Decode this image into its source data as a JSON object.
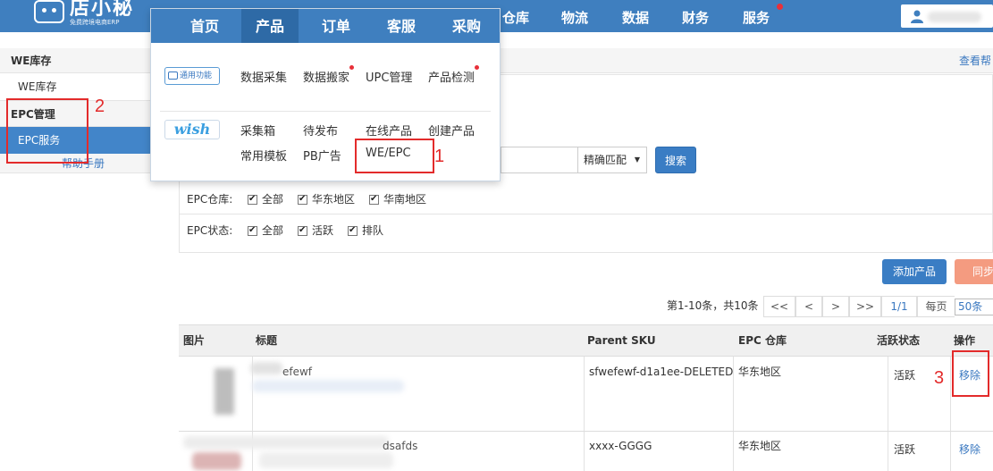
{
  "logo": {
    "name": "店小秘",
    "sub": "免费跨境电商ERP"
  },
  "nav": {
    "right_items": [
      "仓库",
      "物流",
      "数据",
      "财务",
      "服务"
    ]
  },
  "menu": {
    "tabs": [
      "首页",
      "产品",
      "订单",
      "客服",
      "采购"
    ],
    "common_badge": "通用功能",
    "common_items": [
      "数据采集",
      "数据搬家",
      "UPC管理",
      "产品检测"
    ],
    "wish_badge": "wish",
    "wish_items_row1": [
      "采集箱",
      "待发布",
      "在线产品",
      "创建产品"
    ],
    "wish_items_row2": [
      "常用模板",
      "PB广告",
      "WE/EPC"
    ]
  },
  "sidebar": {
    "we_group": "WE库存",
    "we_item": "WE库存",
    "epc_group": "EPC管理",
    "epc_item": "EPC服务",
    "help": "帮助手册"
  },
  "breadcrumb": {
    "help_link": "查看帮"
  },
  "search": {
    "match_mode": "精确匹配",
    "button": "搜索"
  },
  "filters": {
    "warehouse_label": "EPC仓库:",
    "warehouse_options": [
      "全部",
      "华东地区",
      "华南地区"
    ],
    "status_label": "EPC状态:",
    "status_options": [
      "全部",
      "活跃",
      "排队"
    ]
  },
  "actions": {
    "add": "添加产品",
    "sync": "同步"
  },
  "pager": {
    "summary": "第1-10条，共10条",
    "first": "<<",
    "prev": "<",
    "next": ">",
    "last": ">>",
    "page": "1/1",
    "per_page_label": "每页",
    "per_page_value": "50条"
  },
  "table": {
    "headers": [
      "图片",
      "标题",
      "Parent SKU",
      "EPC 仓库",
      "活跃状态",
      "操作"
    ],
    "rows": [
      {
        "title": "efewf",
        "sku": "sfwefewf-d1a1ee-DELETED",
        "warehouse": "华东地区",
        "status": "活跃",
        "action": "移除"
      },
      {
        "title": "dsafds",
        "sku": "xxxx-GGGG",
        "warehouse": "华东地区",
        "status": "活跃",
        "action": "移除"
      }
    ]
  },
  "annotations": [
    "1",
    "2",
    "3"
  ],
  "colors": {
    "nav": "#3f7fbf",
    "accent": "#3a7dc4",
    "annotation": "#e32b2b",
    "sync": "#f49b80"
  }
}
